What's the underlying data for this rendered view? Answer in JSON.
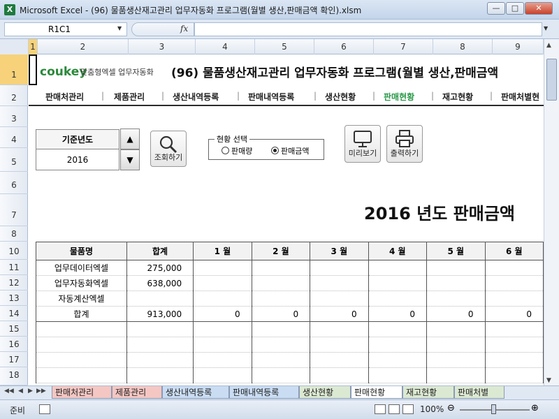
{
  "window": {
    "title": "Microsoft Excel - (96) 물품생산재고관리 업무자동화 프로그램(월별 생산,판매금액 확인).xlsm",
    "app_icon": "X",
    "minimize_icon": "minimize-icon",
    "maximize_icon": "maximize-icon",
    "close_icon": "close-icon"
  },
  "formula_bar": {
    "name_box": "R1C1",
    "fx_label": "fx",
    "formula": ""
  },
  "grid": {
    "column_headers": [
      "1",
      "2",
      "3",
      "4",
      "5",
      "6",
      "7",
      "8",
      "9"
    ],
    "row_headers": [
      "1",
      "2",
      "3",
      "4",
      "5",
      "6",
      "7",
      "8",
      "10",
      "11",
      "12",
      "13",
      "14",
      "15",
      "16",
      "17",
      "18"
    ]
  },
  "header": {
    "logo": "coukey",
    "logo_sub": "맞춤형엑셀 업무자동화",
    "app_title": "(96) 물품생산재고관리 업무자동화 프로그램(월별 생산,판매금액"
  },
  "menu": {
    "items": [
      "판매처관리",
      "제품관리",
      "생산내역등록",
      "판매내역등록",
      "생산현황",
      "판매현황",
      "재고현황",
      "판매처별현"
    ],
    "active_index": 5,
    "active_color": "#2a9a4a"
  },
  "controls": {
    "year_label": "기준년도",
    "year_value": "2016",
    "up_icon": "triangle-up-icon",
    "down_icon": "triangle-down-icon",
    "search_label": "조회하기",
    "option_legend": "현황 선택",
    "option_qty": "판매량",
    "option_amount": "판매금액",
    "selected_option": "판매금액",
    "preview_label": "미리보기",
    "print_label": "출력하기"
  },
  "report_title": "2016 년도 판매금액",
  "table": {
    "headers": [
      "물품명",
      "합계",
      "1 월",
      "2 월",
      "3 월",
      "4 월",
      "5 월",
      "6 월"
    ],
    "rows": [
      [
        "업무데이터엑셀",
        "275,000",
        "",
        "",
        "",
        "",
        "",
        ""
      ],
      [
        "업무자동화엑셀",
        "638,000",
        "",
        "",
        "",
        "",
        "",
        ""
      ],
      [
        "자동계산엑셀",
        "",
        "",
        "",
        "",
        "",
        "",
        ""
      ],
      [
        "합계",
        "913,000",
        "0",
        "0",
        "0",
        "0",
        "0",
        "0"
      ],
      [
        "",
        "",
        "",
        "",
        "",
        "",
        "",
        ""
      ],
      [
        "",
        "",
        "",
        "",
        "",
        "",
        "",
        ""
      ],
      [
        "",
        "",
        "",
        "",
        "",
        "",
        "",
        ""
      ],
      [
        "",
        "",
        "",
        "",
        "",
        "",
        "",
        ""
      ]
    ]
  },
  "sheet_tabs": {
    "tabs": [
      "판매처관리",
      "제품관리",
      "생산내역등록",
      "판매내역등록",
      "생산현황",
      "판매현황",
      "재고현황",
      "판매처별"
    ],
    "active_index": 5,
    "tab_colors": [
      "#f4c7c3",
      "#f4c7c3",
      "#c9dcf2",
      "#c9dcf2",
      "#dce9d2",
      "#ffffff",
      "#dce9d2",
      "#dce9d2"
    ]
  },
  "status": {
    "ready": "준비",
    "zoom": "100%"
  }
}
